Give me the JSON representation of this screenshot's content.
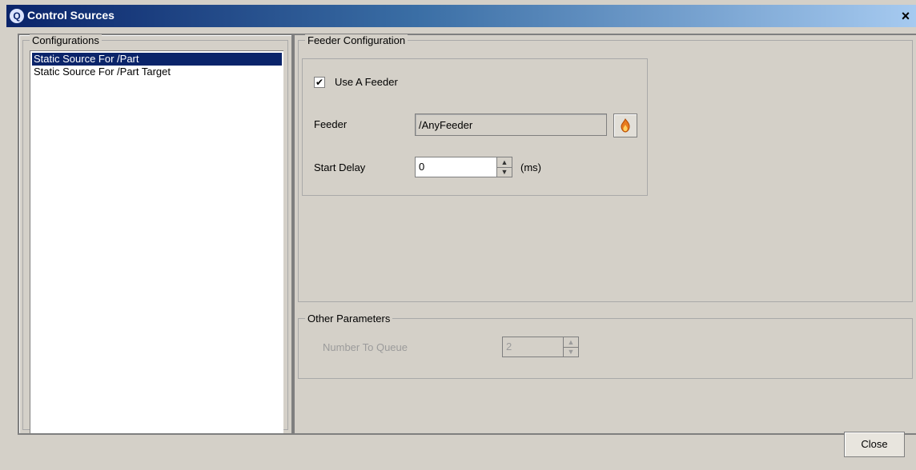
{
  "window": {
    "title": "Control Sources",
    "close_glyph": "×"
  },
  "configurations": {
    "label": "Configurations",
    "items": [
      {
        "label": "Static Source For /Part",
        "selected": true
      },
      {
        "label": "Static Source For /Part Target",
        "selected": false
      }
    ]
  },
  "feeder_config": {
    "label": "Feeder Configuration",
    "use_feeder_label": "Use A Feeder",
    "use_feeder_checked": true,
    "checkbox_glyph": "✔",
    "feeder_label": "Feeder",
    "feeder_value": "/AnyFeeder",
    "browse_icon": "flame-icon",
    "start_delay_label": "Start Delay",
    "start_delay_value": "0",
    "start_delay_unit": "(ms)"
  },
  "other_params": {
    "label": "Other Parameters",
    "number_to_queue_label": "Number To Queue",
    "number_to_queue_value": "2"
  },
  "buttons": {
    "close_label": "Close"
  },
  "colors": {
    "selection": "#0a246a",
    "title_bar_start": "#0a246a",
    "title_bar_end": "#a6caf0"
  }
}
